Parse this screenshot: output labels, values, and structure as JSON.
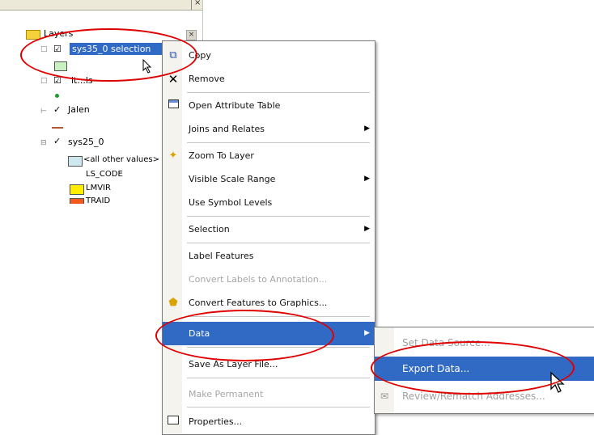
{
  "toc": {
    "layers_label": "Layers",
    "layer1_label": "sys35_0 selection",
    "layer2_label": "lt...ls",
    "layer3_label": "Jalen",
    "layer4_label": "sys25_0",
    "sub_label1": "<all other values>",
    "sub_label2": "LS_CODE",
    "sub_label3": "LMVIR",
    "sub_label4": "TRAID"
  },
  "menu": {
    "items": [
      {
        "label": "Copy",
        "icon": "copy-icon"
      },
      {
        "label": "Remove",
        "icon": "remove-icon"
      },
      {
        "label": "Open Attribute Table",
        "icon": "table-icon"
      },
      {
        "label": "Joins and Relates",
        "icon": ""
      },
      {
        "label": "Zoom To Layer",
        "icon": "zoom-to-layer-icon"
      },
      {
        "label": "Visible Scale Range",
        "icon": ""
      },
      {
        "label": "Use Symbol Levels",
        "icon": ""
      },
      {
        "label": "Selection",
        "icon": ""
      },
      {
        "label": "Label Features",
        "icon": ""
      },
      {
        "label": "Convert Labels to Annotation...",
        "icon": ""
      },
      {
        "label": "Convert Features to Graphics...",
        "icon": "convert-graphics-icon"
      },
      {
        "label": "Data",
        "icon": ""
      },
      {
        "label": "Save As Layer File...",
        "icon": ""
      },
      {
        "label": "Make Permanent",
        "icon": ""
      },
      {
        "label": "Properties...",
        "icon": "properties-icon"
      }
    ]
  },
  "submenu": {
    "items": [
      {
        "label": "Set Data Source..."
      },
      {
        "label": "Export Data..."
      },
      {
        "label": "Review/Rematch Addresses..."
      }
    ]
  },
  "colors": {
    "highlight": "#316ac5",
    "annotation": "#e00000"
  }
}
